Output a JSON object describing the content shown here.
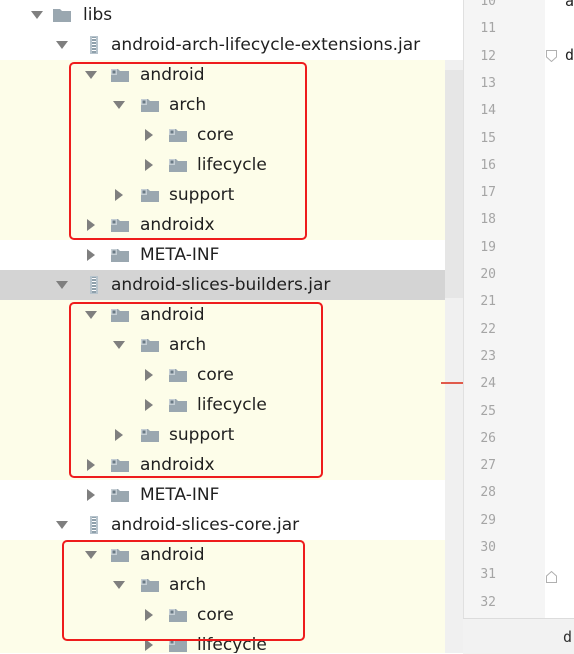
{
  "tree": {
    "rows": [
      {
        "label": "libs",
        "kind": "folder",
        "expanded": true,
        "bg": "jar"
      },
      {
        "label": "android-arch-lifecycle-extensions.jar",
        "kind": "jar",
        "expanded": true,
        "bg": "jar"
      },
      {
        "label": "android",
        "kind": "package",
        "expanded": true,
        "bg": "pkg"
      },
      {
        "label": "arch",
        "kind": "package",
        "expanded": true,
        "bg": "pkg"
      },
      {
        "label": "core",
        "kind": "package",
        "expanded": false,
        "bg": "pkg"
      },
      {
        "label": "lifecycle",
        "kind": "package",
        "expanded": false,
        "bg": "pkg"
      },
      {
        "label": "support",
        "kind": "package",
        "expanded": false,
        "bg": "pkg"
      },
      {
        "label": "androidx",
        "kind": "package",
        "expanded": false,
        "bg": "pkg"
      },
      {
        "label": "META-INF",
        "kind": "package",
        "expanded": false,
        "bg": "meta"
      },
      {
        "label": "android-slices-builders.jar",
        "kind": "jar",
        "expanded": true,
        "bg": "selected"
      },
      {
        "label": "android",
        "kind": "package",
        "expanded": true,
        "bg": "pkg"
      },
      {
        "label": "arch",
        "kind": "package",
        "expanded": true,
        "bg": "pkg"
      },
      {
        "label": "core",
        "kind": "package",
        "expanded": false,
        "bg": "pkg"
      },
      {
        "label": "lifecycle",
        "kind": "package",
        "expanded": false,
        "bg": "pkg"
      },
      {
        "label": "support",
        "kind": "package",
        "expanded": false,
        "bg": "pkg"
      },
      {
        "label": "androidx",
        "kind": "package",
        "expanded": false,
        "bg": "pkg"
      },
      {
        "label": "META-INF",
        "kind": "package",
        "expanded": false,
        "bg": "meta"
      },
      {
        "label": "android-slices-core.jar",
        "kind": "jar",
        "expanded": true,
        "bg": "jar"
      },
      {
        "label": "android",
        "kind": "package",
        "expanded": true,
        "bg": "pkg"
      },
      {
        "label": "arch",
        "kind": "package",
        "expanded": true,
        "bg": "pkg"
      },
      {
        "label": "core",
        "kind": "package",
        "expanded": false,
        "bg": "pkg"
      },
      {
        "label": "lifecycle",
        "kind": "package",
        "expanded": false,
        "bg": "pkg"
      }
    ]
  },
  "gutter": {
    "line_numbers": [
      "10",
      "11",
      "12",
      "13",
      "14",
      "15",
      "16",
      "17",
      "18",
      "19",
      "20",
      "21",
      "22",
      "23",
      "24",
      "25",
      "26",
      "27",
      "28",
      "29",
      "30",
      "31",
      "32"
    ]
  },
  "editor": {
    "code_chars": [
      "a",
      "d"
    ],
    "bottom_text": "d"
  },
  "colors": {
    "highlight_border": "#ee1c1c",
    "package_row_bg": "#fdfde9",
    "selected_row_bg": "#d4d4d4"
  }
}
